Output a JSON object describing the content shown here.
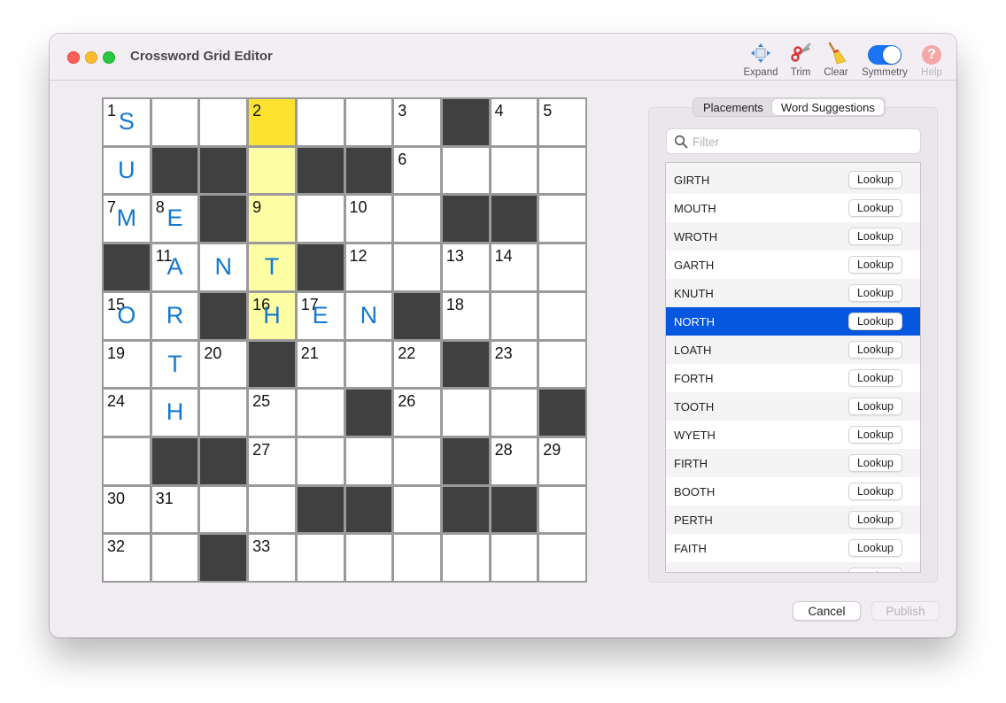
{
  "window": {
    "title": "Crossword Grid Editor"
  },
  "toolbar": {
    "items": [
      {
        "label": "Expand",
        "icon": "expand-icon",
        "enabled": true
      },
      {
        "label": "Trim",
        "icon": "scissors-icon",
        "enabled": true
      },
      {
        "label": "Clear",
        "icon": "broom-icon",
        "enabled": true
      },
      {
        "label": "Symmetry",
        "icon": "toggle-switch",
        "enabled": true,
        "on": true
      },
      {
        "label": "Help",
        "icon": "help-icon",
        "enabled": false,
        "glyph": "?"
      }
    ]
  },
  "grid": {
    "size": 10,
    "colors": {
      "black": "#404040",
      "cursor": "#fde330",
      "highlight": "#fefea4",
      "letter": "#1378cf"
    },
    "cells": [
      [
        {
          "n": "1",
          "l": "S"
        },
        {},
        {},
        {
          "n": "2",
          "s": "cursor"
        },
        {},
        {},
        {
          "n": "3"
        },
        {
          "b": 1
        },
        {
          "n": "4"
        },
        {
          "n": "5"
        }
      ],
      [
        {
          "l": "U"
        },
        {
          "b": 1
        },
        {
          "b": 1
        },
        {
          "s": "hl"
        },
        {
          "b": 1
        },
        {
          "b": 1
        },
        {
          "n": "6"
        },
        {},
        {},
        {}
      ],
      [
        {
          "n": "7",
          "l": "M"
        },
        {
          "n": "8",
          "l": "E"
        },
        {
          "b": 1
        },
        {
          "n": "9",
          "s": "hl"
        },
        {},
        {
          "n": "10"
        },
        {},
        {
          "b": 1
        },
        {
          "b": 1
        },
        {}
      ],
      [
        {
          "b": 1
        },
        {
          "n": "11",
          "l": "A"
        },
        {
          "l": "N"
        },
        {
          "l": "T",
          "s": "hl"
        },
        {
          "b": 1
        },
        {
          "n": "12"
        },
        {},
        {
          "n": "13"
        },
        {
          "n": "14"
        },
        {}
      ],
      [
        {
          "n": "15",
          "l": "O"
        },
        {
          "l": "R"
        },
        {
          "b": 1
        },
        {
          "n": "16",
          "l": "H",
          "s": "hl"
        },
        {
          "n": "17",
          "l": "E"
        },
        {
          "l": "N"
        },
        {
          "b": 1
        },
        {
          "n": "18"
        },
        {},
        {}
      ],
      [
        {
          "n": "19"
        },
        {
          "l": "T"
        },
        {
          "n": "20"
        },
        {
          "b": 1
        },
        {
          "n": "21"
        },
        {},
        {
          "n": "22"
        },
        {
          "b": 1
        },
        {
          "n": "23"
        },
        {}
      ],
      [
        {
          "n": "24"
        },
        {
          "l": "H"
        },
        {},
        {
          "n": "25"
        },
        {},
        {
          "b": 1
        },
        {
          "n": "26"
        },
        {},
        {},
        {
          "b": 1
        }
      ],
      [
        {},
        {
          "b": 1
        },
        {
          "b": 1
        },
        {
          "n": "27"
        },
        {},
        {},
        {},
        {
          "b": 1
        },
        {
          "n": "28"
        },
        {
          "n": "29"
        }
      ],
      [
        {
          "n": "30"
        },
        {
          "n": "31"
        },
        {},
        {},
        {
          "b": 1
        },
        {
          "b": 1
        },
        {},
        {
          "b": 1
        },
        {
          "b": 1
        },
        {}
      ],
      [
        {
          "n": "32"
        },
        {},
        {
          "b": 1
        },
        {
          "n": "33"
        },
        {},
        {},
        {},
        {},
        {},
        {}
      ]
    ]
  },
  "panel": {
    "tabs": [
      {
        "label": "Placements",
        "active": false
      },
      {
        "label": "Word Suggestions",
        "active": true
      }
    ],
    "filter": {
      "placeholder": "Filter",
      "value": ""
    },
    "lookup_label": "Lookup",
    "words": [
      {
        "word": "GIRTH",
        "selected": false
      },
      {
        "word": "MOUTH",
        "selected": false
      },
      {
        "word": "WROTH",
        "selected": false
      },
      {
        "word": "GARTH",
        "selected": false
      },
      {
        "word": "KNUTH",
        "selected": false
      },
      {
        "word": "NORTH",
        "selected": true
      },
      {
        "word": "LOATH",
        "selected": false
      },
      {
        "word": "FORTH",
        "selected": false
      },
      {
        "word": "TOOTH",
        "selected": false
      },
      {
        "word": "WYETH",
        "selected": false
      },
      {
        "word": "FIRTH",
        "selected": false
      },
      {
        "word": "BOOTH",
        "selected": false
      },
      {
        "word": "PERTH",
        "selected": false
      },
      {
        "word": "FAITH",
        "selected": false
      },
      {
        "word": "",
        "selected": false
      }
    ],
    "selection_color": "#0557e0"
  },
  "footer": {
    "cancel_label": "Cancel",
    "publish_label": "Publish",
    "publish_enabled": false
  }
}
